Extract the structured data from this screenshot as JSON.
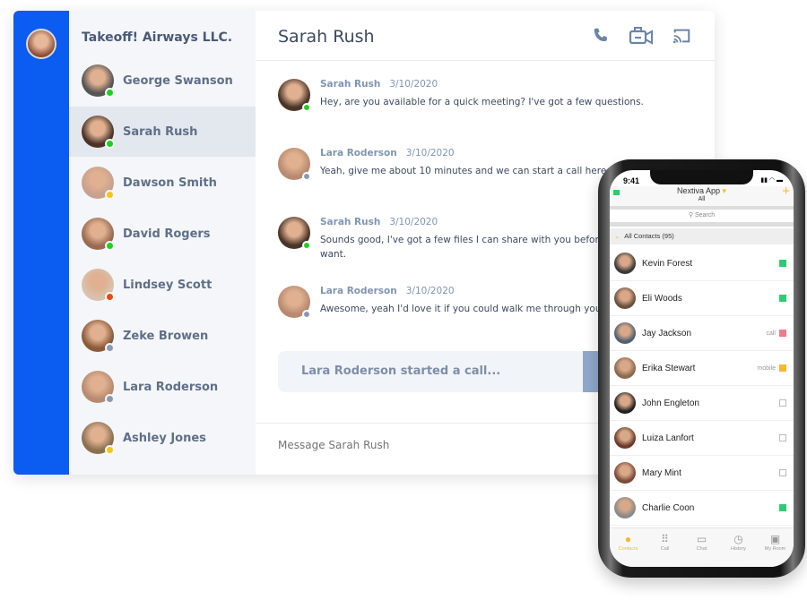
{
  "org": "Takeoff! Airways LLC.",
  "contacts": [
    {
      "name": "George Swanson",
      "status": "#1ed01e",
      "color": "#555"
    },
    {
      "name": "Sarah Rush",
      "status": "#1ed01e",
      "color": "#4a3428",
      "selected": true
    },
    {
      "name": "Dawson Smith",
      "status": "#f5c518",
      "color": "#c9a190"
    },
    {
      "name": "David Rogers",
      "status": "#1ed01e",
      "color": "#9a6a52"
    },
    {
      "name": "Lindsey Scott",
      "status": "#e54b12",
      "color": "#d8c2ae"
    },
    {
      "name": "Zeke Browen",
      "status": "#8a9ab0",
      "color": "#8a5a3a"
    },
    {
      "name": "Lara Roderson",
      "status": "#8a9ab0",
      "color": "#b88a70"
    },
    {
      "name": "Ashley Jones",
      "status": "#f5c518",
      "color": "#8a7050"
    }
  ],
  "chat": {
    "title": "Sarah Rush",
    "icons": [
      "phone-icon",
      "video-camera-icon",
      "cast-icon"
    ],
    "messages": [
      {
        "author": "Sarah Rush",
        "date": "3/10/2020",
        "text": "Hey, are you available for a quick meeting? I've got a few questions.",
        "status": "#1ed01e",
        "color": "#4a3428"
      },
      {
        "author": "Lara Roderson",
        "date": "3/10/2020",
        "text": "Yeah, give me about 10 minutes and we can start a call here.",
        "status": "#8a9ab0",
        "color": "#b88a70"
      },
      {
        "author": "Sarah Rush",
        "date": "3/10/2020",
        "text": "Sounds good, I've got a few files I can share with you before ha screen if you want.",
        "status": "#1ed01e",
        "color": "#4a3428"
      },
      {
        "author": "Lara Roderson",
        "date": "3/10/2020",
        "text": "Awesome, yeah I'd love it if you could walk me through your ide",
        "status": "#8a9ab0",
        "color": "#b88a70"
      }
    ],
    "call_notice": "Lara Roderson started a call...",
    "input_placeholder": "Message Sarah Rush"
  },
  "phone": {
    "time": "9:41",
    "title": "Nextiva App",
    "subtitle": "All",
    "search_placeholder": "Search",
    "group": "All Contacts (95)",
    "contacts": [
      {
        "name": "Kevin Forest",
        "label": "",
        "indicator": "#2ecc71",
        "color": "#3a3a3a"
      },
      {
        "name": "Eli Woods",
        "label": "",
        "indicator": "#2ecc71",
        "color": "#6a5040"
      },
      {
        "name": "Jay Jackson",
        "label": "call",
        "indicator": "#f07a8a",
        "color": "#506070"
      },
      {
        "name": "Erika Stewart",
        "label": "mobile",
        "indicator": "#f5b82e",
        "color": "#8a6a50"
      },
      {
        "name": "John Engleton",
        "label": "",
        "indicator": "",
        "color": "#222"
      },
      {
        "name": "Luiza Lanfort",
        "label": "",
        "indicator": "",
        "color": "#6a3a2a"
      },
      {
        "name": "Mary Mint",
        "label": "",
        "indicator": "",
        "color": "#7a4a3a"
      },
      {
        "name": "Charlie Coon",
        "label": "",
        "indicator": "#2ecc71",
        "color": "#8a8a8a"
      }
    ],
    "tabs": [
      {
        "label": "Contacts",
        "glyph": "●",
        "active": true
      },
      {
        "label": "Call",
        "glyph": "⠿"
      },
      {
        "label": "Chat",
        "glyph": "▭"
      },
      {
        "label": "History",
        "glyph": "◷"
      },
      {
        "label": "My Room",
        "glyph": "▣"
      }
    ]
  }
}
